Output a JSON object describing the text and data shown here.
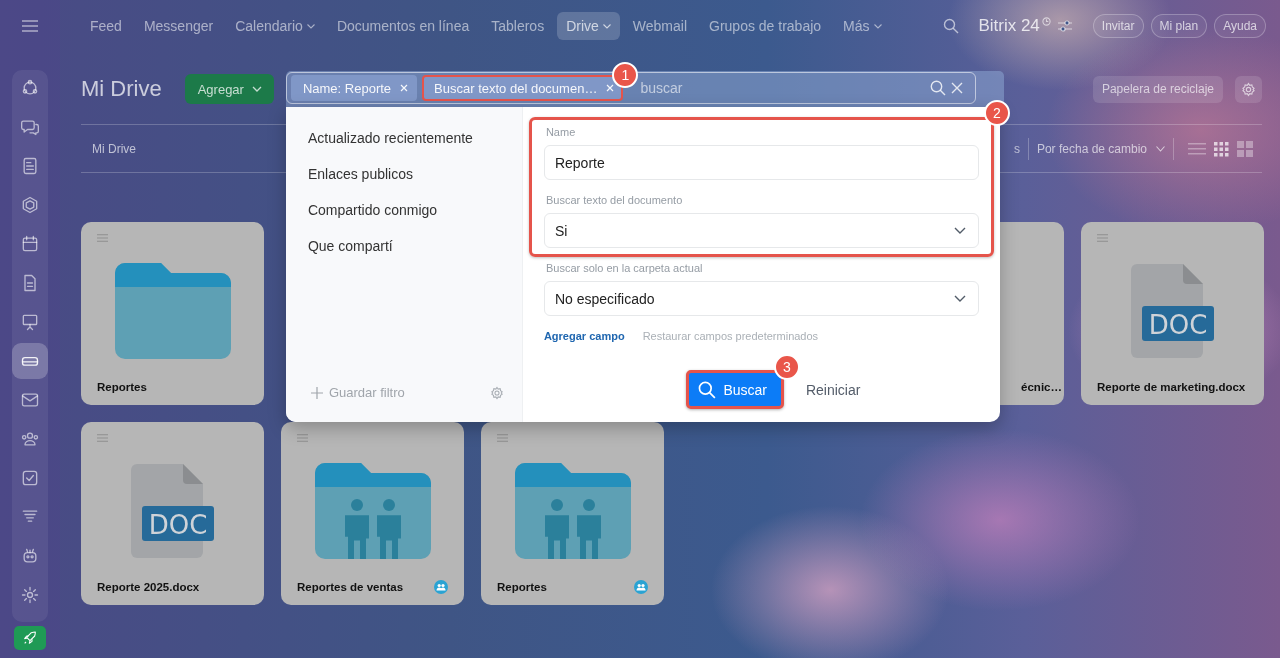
{
  "sidebar": {
    "items": [
      {
        "selected": false
      },
      {
        "selected": false
      },
      {
        "selected": false
      },
      {
        "selected": false
      },
      {
        "selected": false
      },
      {
        "selected": false
      },
      {
        "selected": false
      },
      {
        "selected": true
      },
      {
        "selected": false
      },
      {
        "selected": false
      },
      {
        "selected": false
      },
      {
        "selected": false
      },
      {
        "selected": false
      },
      {
        "selected": false
      }
    ]
  },
  "top_nav": {
    "items": [
      {
        "label": "Feed",
        "dropdown": false,
        "selected": false
      },
      {
        "label": "Messenger",
        "dropdown": false,
        "selected": false
      },
      {
        "label": "Calendario",
        "dropdown": true,
        "selected": false
      },
      {
        "label": "Documentos en línea",
        "dropdown": false,
        "selected": false
      },
      {
        "label": "Tableros",
        "dropdown": false,
        "selected": false
      },
      {
        "label": "Drive",
        "dropdown": true,
        "selected": true
      },
      {
        "label": "Webmail",
        "dropdown": false,
        "selected": false
      },
      {
        "label": "Grupos de trabajo",
        "dropdown": false,
        "selected": false
      },
      {
        "label": "Más",
        "dropdown": true,
        "selected": false
      }
    ],
    "logo": "Bitrix 24",
    "buttons": [
      "Invitar",
      "Mi plan",
      "Ayuda"
    ]
  },
  "header": {
    "title": "Mi Drive",
    "add_button": "Agregar",
    "search": {
      "chips": [
        {
          "label": "Name: Reporte",
          "highlighted": false
        },
        {
          "label": "Buscar texto del documen…",
          "highlighted": true,
          "badge": "1"
        }
      ],
      "placeholder": "buscar"
    },
    "trash_button": "Papelera de reciclaje"
  },
  "toolbar": {
    "breadcrumb": "Mi Drive",
    "filter_fragment": "s",
    "sort": "Por fecha de cambio",
    "views": [
      {
        "selected": false
      },
      {
        "selected": true
      },
      {
        "selected": false
      }
    ]
  },
  "cards": [
    [
      {
        "kind": "folder",
        "title": "Reportes",
        "shared": false
      },
      {
        "kind": "partial",
        "title": "écnic…",
        "shared": false
      },
      {
        "kind": "doc",
        "title": "Reporte de marketing.docx",
        "icon_label": "DOC",
        "shared": false
      }
    ],
    [
      {
        "kind": "doc",
        "title": "Reporte 2025.docx",
        "icon_label": "DOC",
        "shared": false
      },
      {
        "kind": "shared-folder",
        "title": "Reportes de ventas",
        "shared": true
      },
      {
        "kind": "shared-folder",
        "title": "Reportes",
        "shared": true
      }
    ]
  ],
  "filter_popup": {
    "presets": [
      "Actualizado recientemente",
      "Enlaces publicos",
      "Compartido conmigo",
      "Que compartí"
    ],
    "save_filter": "Guardar filtro",
    "field_groups": [
      {
        "highlighted": true,
        "badge": "2",
        "fields": [
          {
            "kind": "text",
            "label": "Name",
            "value": "Reporte"
          },
          {
            "kind": "select",
            "label": "Buscar texto del documento",
            "value": "Si"
          }
        ]
      },
      {
        "highlighted": false,
        "fields": [
          {
            "kind": "select",
            "label": "Buscar solo en la carpeta actual",
            "value": "No especificado"
          }
        ]
      }
    ],
    "add_field": "Agregar campo",
    "restore_fields": "Restaurar campos predeterminados",
    "search_button": {
      "label": "Buscar",
      "highlighted": true,
      "badge": "3"
    },
    "reset_button": "Reiniciar"
  }
}
